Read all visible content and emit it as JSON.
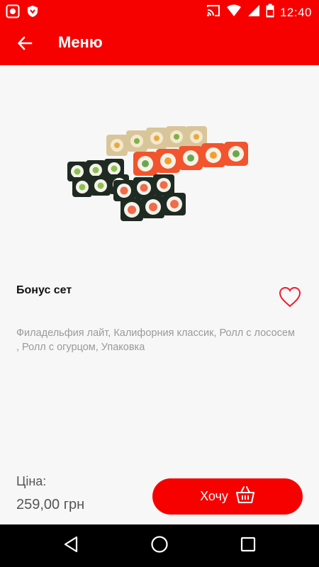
{
  "status_bar": {
    "time": "12:40",
    "icons": [
      "screen-record-icon",
      "shield-icon",
      "cast-icon",
      "wifi-icon",
      "signal-icon",
      "battery-icon"
    ]
  },
  "app_bar": {
    "title": "Меню",
    "back_icon": "arrow-left-icon"
  },
  "product": {
    "image_alt": "sushi-set",
    "name": "Бонус сет",
    "description": "Филадельфия лайт, Калифорния классик, Ролл с лососем , Ролл с огурцом, Упаковка",
    "favorite_icon": "heart-outline-icon"
  },
  "price": {
    "label": "Ціна:",
    "value": "259,00 грн"
  },
  "buy_button": {
    "label": "Хочу",
    "icon": "basket-icon"
  },
  "colors": {
    "accent": "#f70000",
    "text_muted": "#9a9a9a",
    "background": "#f7f7f7"
  },
  "nav_bar": {
    "items": [
      "back-triangle-icon",
      "home-circle-icon",
      "recents-square-icon"
    ]
  }
}
